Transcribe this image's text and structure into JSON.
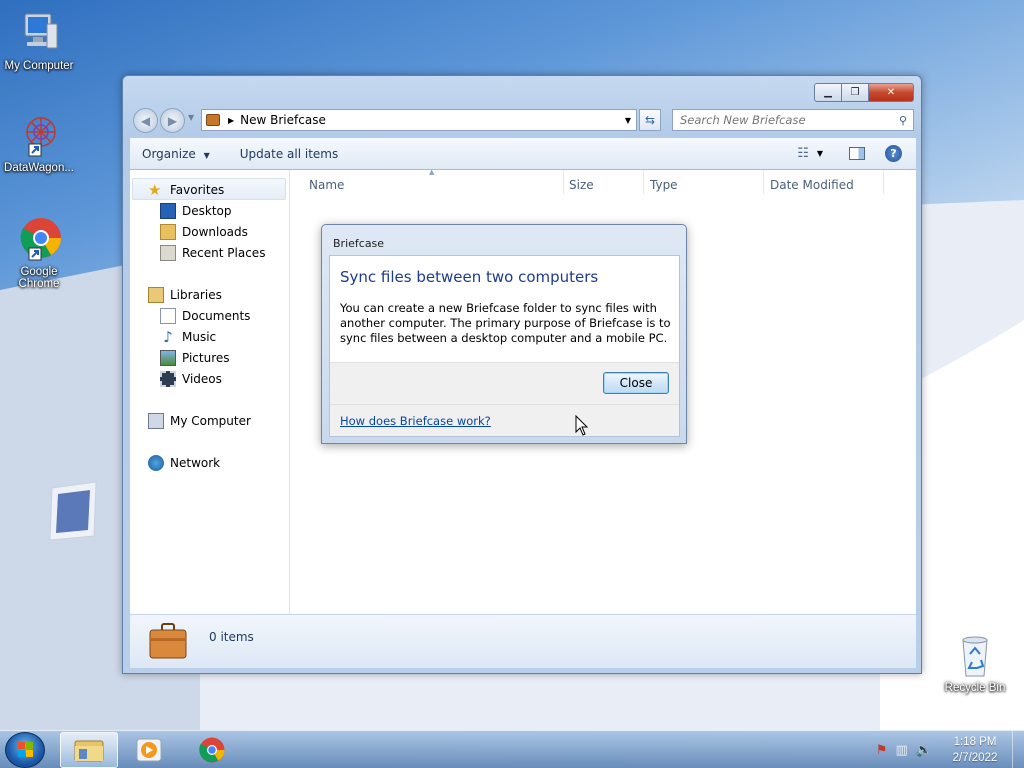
{
  "desktop": {
    "icons": [
      {
        "label": "My Computer"
      },
      {
        "label": "DataWagon..."
      },
      {
        "label": "Google Chrome"
      },
      {
        "label": "Recycle Bin"
      }
    ]
  },
  "window": {
    "address": {
      "crumb": "New Briefcase",
      "search_placeholder": "Search New Briefcase"
    },
    "toolbar": {
      "organize": "Organize",
      "update_all": "Update all items"
    },
    "nav": {
      "favorites": "Favorites",
      "favorites_items": [
        "Desktop",
        "Downloads",
        "Recent Places"
      ],
      "libraries": "Libraries",
      "libraries_items": [
        "Documents",
        "Music",
        "Pictures",
        "Videos"
      ],
      "computer": "My Computer",
      "network": "Network"
    },
    "columns": [
      "Name",
      "Size",
      "Type",
      "Date Modified"
    ],
    "details": {
      "count": "0 items"
    }
  },
  "dialog": {
    "title": "Briefcase",
    "heading": "Sync files between two computers",
    "text": "You can create a new Briefcase folder to sync files with another computer. The primary purpose of Briefcase is to sync files between a desktop computer and a mobile PC.",
    "close_label": "Close",
    "link": "How does Briefcase work?"
  },
  "taskbar": {
    "time": "1:18 PM",
    "date": "2/7/2022"
  }
}
